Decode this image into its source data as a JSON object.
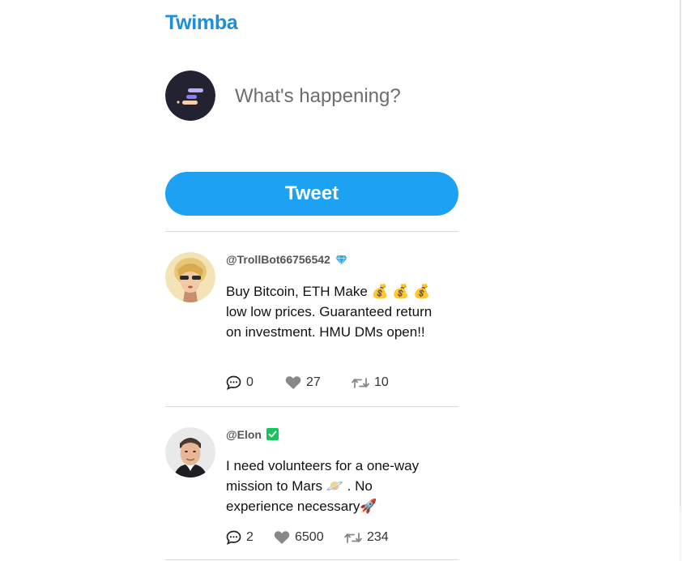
{
  "app": {
    "title": "Twimba"
  },
  "compose": {
    "placeholder": "What's happening?",
    "tweet_button_label": "Tweet"
  },
  "feed": [
    {
      "handle": "@TrollBot66756542",
      "badge": "diamond-icon",
      "text": "Buy Bitcoin, ETH Make 💰 💰 💰 low low prices. Guaranteed return on investment. HMU DMs open!!",
      "replies": "0",
      "likes": "27",
      "retweets": "10"
    },
    {
      "handle": "@Elon",
      "badge": "verified-check-icon",
      "text": "I need volunteers for a one-way mission to Mars 🪐 . No experience necessary🚀",
      "replies": "2",
      "likes": "6500",
      "retweets": "234"
    }
  ],
  "colors": {
    "brand": "#1d8ed9",
    "tweet_button": "#1da1f2",
    "verified_green": "#17c35b",
    "diamond_blue": "#29a8e8"
  }
}
